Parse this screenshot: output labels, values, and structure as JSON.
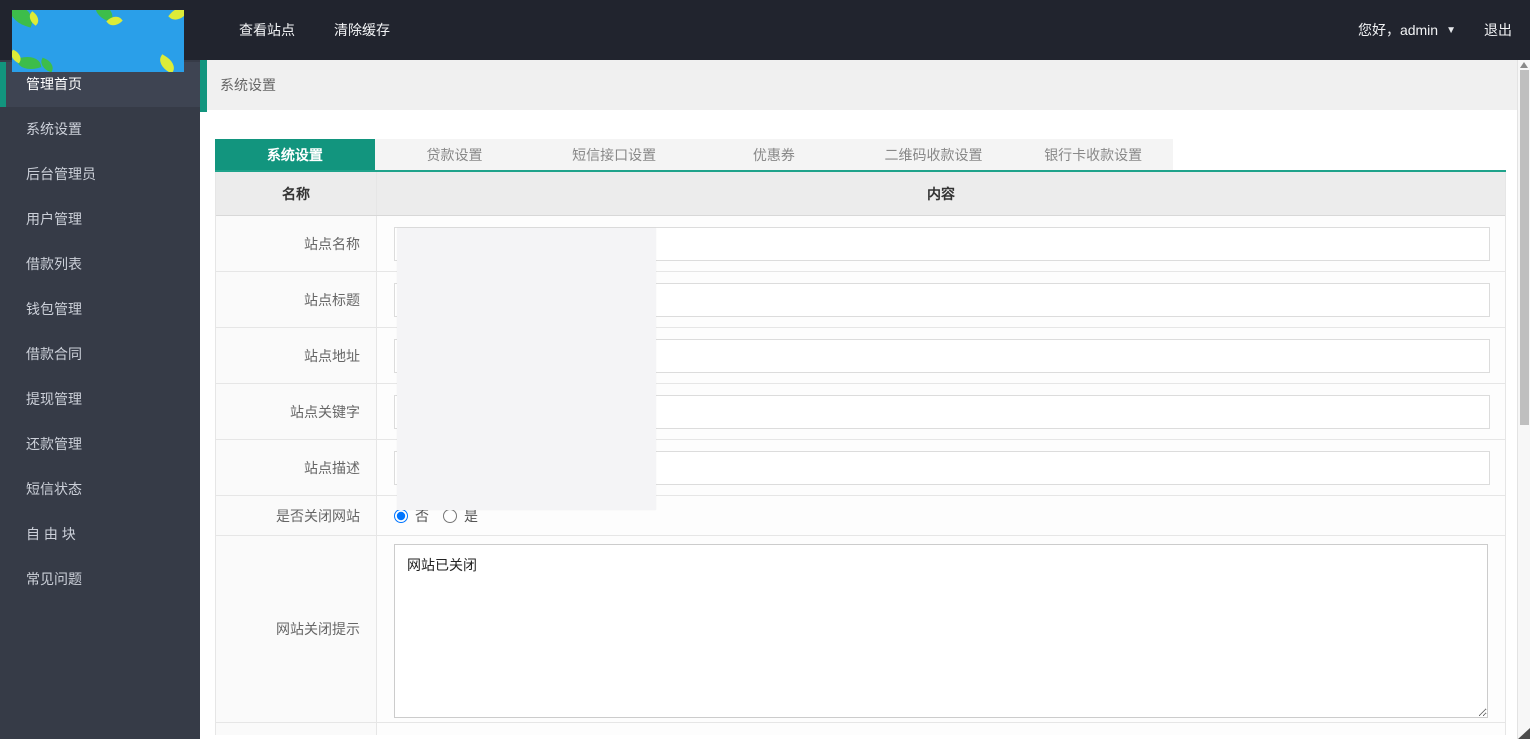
{
  "topbar": {
    "nav_items": [
      "查看站点",
      "清除缓存"
    ],
    "greeting": "您好，admin",
    "logout_label": "退出"
  },
  "sidebar": {
    "items": [
      {
        "label": "管理首页",
        "active": true
      },
      {
        "label": "系统设置",
        "active": false
      },
      {
        "label": "后台管理员",
        "active": false
      },
      {
        "label": "用户管理",
        "active": false
      },
      {
        "label": "借款列表",
        "active": false
      },
      {
        "label": "钱包管理",
        "active": false
      },
      {
        "label": "借款合同",
        "active": false
      },
      {
        "label": "提现管理",
        "active": false
      },
      {
        "label": "还款管理",
        "active": false
      },
      {
        "label": "短信状态",
        "active": false
      },
      {
        "label": "自 由 块",
        "active": false
      },
      {
        "label": "常见问题",
        "active": false
      }
    ]
  },
  "breadcrumb": "系统设置",
  "tabs": [
    {
      "label": "系统设置",
      "active": true
    },
    {
      "label": "贷款设置",
      "active": false
    },
    {
      "label": "短信接口设置",
      "active": false
    },
    {
      "label": "优惠券",
      "active": false
    },
    {
      "label": "二维码收款设置",
      "active": false
    },
    {
      "label": "银行卡收款设置",
      "active": false
    }
  ],
  "settings_table": {
    "headers": [
      "名称",
      "内容"
    ],
    "text_rows": [
      {
        "label": "站点名称",
        "value": ""
      },
      {
        "label": "站点标题",
        "value": ""
      },
      {
        "label": "站点地址",
        "value": ""
      },
      {
        "label": "站点关键字",
        "value": ""
      },
      {
        "label": "站点描述",
        "value": ""
      }
    ],
    "radio_row": {
      "label": "是否关闭网站",
      "options": [
        "否",
        "是"
      ],
      "selected_index": 0
    },
    "textarea_row": {
      "label": "网站关闭提示",
      "value": "网站已关闭"
    }
  },
  "colors": {
    "accent_teal": "#12957e",
    "topbar_bg": "#21242e",
    "sidebar_bg": "#363b47",
    "logo_blue": "#2a9fe9"
  }
}
